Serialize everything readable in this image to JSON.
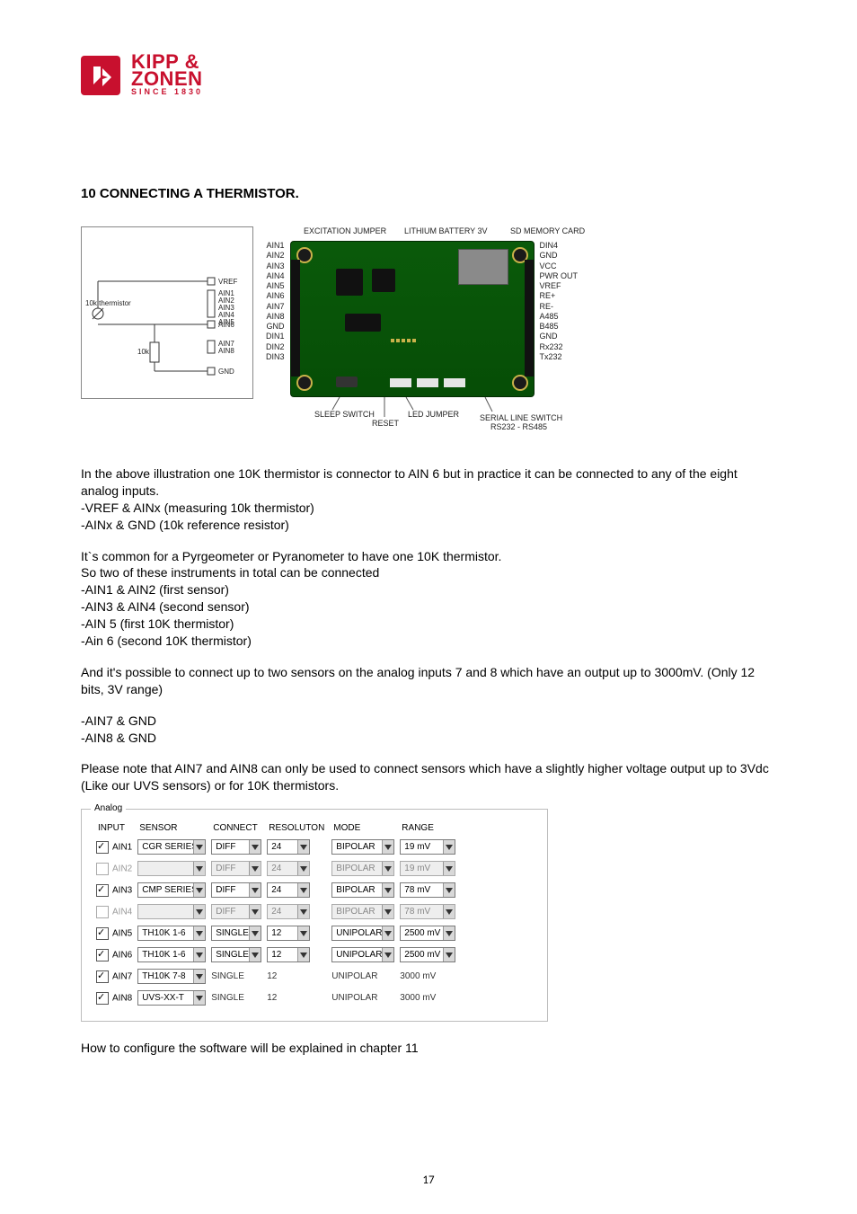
{
  "logo": {
    "line1": "KIPP &",
    "line2": "ZONEN",
    "since": "SINCE 1830"
  },
  "header": {
    "title": "10   CONNECTING A THERMISTOR."
  },
  "schematic": {
    "thermistor_label": "10k thermistor",
    "vref": "VREF",
    "ain_block": [
      "AIN1",
      "AIN2",
      "AIN3",
      "AIN4",
      "AIN5"
    ],
    "ain6": "AIN6",
    "ain78": [
      "AIN7",
      "AIN8"
    ],
    "r10k": "10k",
    "gnd": "GND"
  },
  "board": {
    "top_labels": {
      "excitation": "EXCITATION JUMPER",
      "battery": "LITHIUM BATTERY 3V",
      "sd": "SD MEMORY CARD"
    },
    "left_pins": [
      "AIN1",
      "AIN2",
      "AIN3",
      "AIN4",
      "AIN5",
      "AIN6",
      "AIN7",
      "AIN8",
      "GND",
      "DIN1",
      "DIN2",
      "DIN3"
    ],
    "right_pins": [
      "DIN4",
      "GND",
      "VCC",
      "PWR OUT",
      "VREF",
      "RE+",
      "RE-",
      "A485",
      "B485",
      "GND",
      "Rx232",
      "Tx232"
    ],
    "bottom_labels": {
      "sleep": "SLEEP SWITCH",
      "led": "LED JUMPER",
      "reset": "RESET",
      "serial1": "SERIAL LINE SWITCH",
      "serial2": "RS232 - RS485"
    }
  },
  "body": {
    "p1a": "In the above illustration one 10K thermistor is connector to AIN 6 but in practice it can be connected to any of the eight analog inputs.",
    "p1b": "-VREF & AINx (measuring 10k thermistor)",
    "p1c": "-AINx & GND  (10k reference resistor)",
    "p2a": "It`s common for a Pyrgeometer or Pyranometer to have one 10K thermistor.",
    "p2b": "So two of these instruments in total can be connected",
    "p2c": "-AIN1 & AIN2 (first sensor)",
    "p2d": "-AIN3 & AIN4 (second sensor)",
    "p2e": "-AIN 5 (first 10K thermistor)",
    "p2f": "-Ain 6 (second 10K thermistor)",
    "p3a": "And it's possible to connect up to two sensors on the analog inputs 7 and 8 which have an output up to 3000mV. (Only 12 bits, 3V range)",
    "p4a": "-AIN7 & GND",
    "p4b": "-AIN8 & GND",
    "p5a": "Please note that AIN7 and AIN8 can only be used to connect sensors which have a slightly higher voltage output up to 3Vdc (Like our UVS sensors) or for 10K thermistors."
  },
  "analog": {
    "legend": "Analog",
    "headers": {
      "input": "INPUT",
      "sensor": "SENSOR",
      "connect": "CONNECT",
      "resolution": "RESOLUTON",
      "mode": "MODE",
      "range": "RANGE"
    },
    "rows": [
      {
        "label": "AIN1",
        "enabled": true,
        "checked": true,
        "sensor": "CGR SERIES",
        "connect": "DIFF",
        "resolution": "24",
        "mode": "BIPOLAR",
        "range": "19 mV",
        "static": false
      },
      {
        "label": "AIN2",
        "enabled": false,
        "checked": false,
        "sensor": "",
        "connect": "DIFF",
        "resolution": "24",
        "mode": "BIPOLAR",
        "range": "19 mV",
        "static": false
      },
      {
        "label": "AIN3",
        "enabled": true,
        "checked": true,
        "sensor": "CMP SERIES",
        "connect": "DIFF",
        "resolution": "24",
        "mode": "BIPOLAR",
        "range": "78 mV",
        "static": false
      },
      {
        "label": "AIN4",
        "enabled": false,
        "checked": false,
        "sensor": "",
        "connect": "DIFF",
        "resolution": "24",
        "mode": "BIPOLAR",
        "range": "78 mV",
        "static": false
      },
      {
        "label": "AIN5",
        "enabled": true,
        "checked": true,
        "sensor": "TH10K 1-6",
        "connect": "SINGLE",
        "resolution": "12",
        "mode": "UNIPOLAR",
        "range": "2500 mV",
        "static": false
      },
      {
        "label": "AIN6",
        "enabled": true,
        "checked": true,
        "sensor": "TH10K 1-6",
        "connect": "SINGLE",
        "resolution": "12",
        "mode": "UNIPOLAR",
        "range": "2500 mV",
        "static": false
      },
      {
        "label": "AIN7",
        "enabled": true,
        "checked": true,
        "sensor": "TH10K 7-8",
        "connect": "SINGLE",
        "resolution": "12",
        "mode": "UNIPOLAR",
        "range": "3000 mV",
        "static": true
      },
      {
        "label": "AIN8",
        "enabled": true,
        "checked": true,
        "sensor": "UVS-XX-T",
        "connect": "SINGLE",
        "resolution": "12",
        "mode": "UNIPOLAR",
        "range": "3000 mV",
        "static": true
      }
    ]
  },
  "closing": "How to configure the software will be explained in chapter 11",
  "page_number": "17"
}
